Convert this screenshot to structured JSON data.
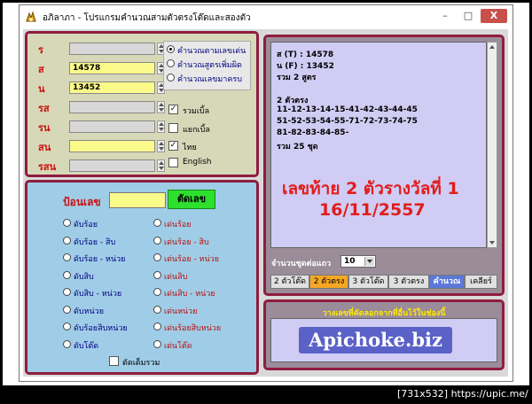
{
  "window": {
    "title": "อภิลาภา - โปรแกรมคำนวณสามตัวตรงโต๊ดและสองตัว",
    "minimize": "–",
    "maximize": "□",
    "close": "X"
  },
  "input_panel": {
    "fields": [
      {
        "label": "ร",
        "value": "",
        "highlighted": false
      },
      {
        "label": "ส",
        "value": "14578",
        "highlighted": true
      },
      {
        "label": "น",
        "value": "13452",
        "highlighted": true
      },
      {
        "label": "รส",
        "value": "",
        "highlighted": false
      },
      {
        "label": "รน",
        "value": "",
        "highlighted": false
      },
      {
        "label": "สน",
        "value": "",
        "highlighted": true
      },
      {
        "label": "รสน",
        "value": "",
        "highlighted": false
      }
    ],
    "modes": [
      {
        "label": "คำนวณตามเลขเด่น",
        "selected": true
      },
      {
        "label": "คำนวณสูตรเพิ่มผิด",
        "selected": false
      },
      {
        "label": "คำนวณเลขมาครบ",
        "selected": false
      }
    ],
    "checks": [
      {
        "label": "รวมเบิ้ล",
        "checked": true
      },
      {
        "label": "แยกเบิ้ล",
        "checked": false
      },
      {
        "label": "ไทย",
        "checked": true
      },
      {
        "label": "English",
        "checked": false
      }
    ]
  },
  "cut_panel": {
    "title": "ป้อนเลข",
    "button": "ตัดเลข",
    "left_options": [
      "ดับร้อย",
      "ดับร้อย - สิบ",
      "ดับร้อย - หน่วย",
      "ดับสิบ",
      "ดับสิบ - หน่วย",
      "ดับหน่วย",
      "ดับร้อยสิบหน่วย",
      "ดับโต๊ด"
    ],
    "right_options": [
      "เด่นร้อย",
      "เด่นร้อย - สิบ",
      "เด่นร้อย - หน่วย",
      "เด่นสิบ",
      "เด่นสิบ - หน่วย",
      "เด่นหน่วย",
      "เด่นร้อยสิบหน่วย",
      "เด่นโต๊ด"
    ],
    "bottom_check": "ตัดเด็มรวม"
  },
  "output_panel": {
    "lines": [
      "ส (T) : 14578",
      "น (F) : 13452",
      "รวม 2 สูตร",
      "",
      "2 ตัวตรง",
      "11-12-13-14-15-41-42-43-44-45",
      "51-52-53-54-55-71-72-73-74-75",
      "81-82-83-84-85-",
      "รวม 25 ชุด"
    ],
    "headline_1": "เลขท้าย 2 ตัวรางวัลที่ 1",
    "headline_2": "16/11/2557",
    "sets_label": "จำนวนชุดต่อแถว",
    "sets_value": "10",
    "tabs": [
      {
        "label": "2 ตัวโต๊ด",
        "style": "normal"
      },
      {
        "label": "2 ตัวตรง",
        "style": "orange"
      },
      {
        "label": "3 ตัวโต๊ด",
        "style": "normal"
      },
      {
        "label": "3 ตัวตรง",
        "style": "normal"
      },
      {
        "label": "คำนวณ",
        "style": "blue"
      },
      {
        "label": "เคลียร์",
        "style": "normal"
      }
    ]
  },
  "paste_panel": {
    "title": "วางเลขที่คัดลอกจากที่อื่นไว้ในช่องนี้",
    "banner": "Apichoke.biz"
  },
  "caption": "[731x532] https://upic.me/"
}
